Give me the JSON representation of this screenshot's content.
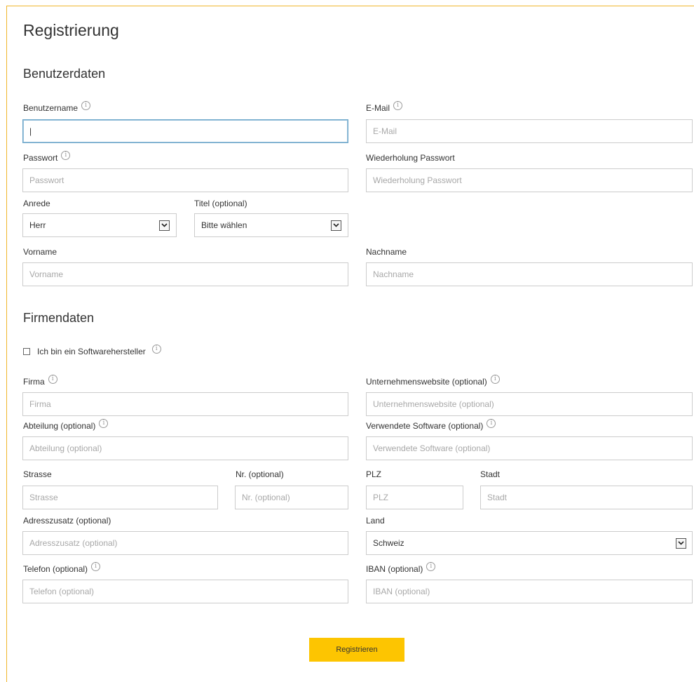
{
  "page": {
    "title": "Registrierung",
    "submit_label": "Registrieren"
  },
  "info_icon_glyph": "i",
  "colors": {
    "accent_border": "#f0b52a",
    "button_bg": "#fdc501",
    "focus_border": "#6aa5c9"
  },
  "sections": {
    "user": {
      "title": "Benutzerdaten"
    },
    "company": {
      "title": "Firmendaten"
    }
  },
  "fields": {
    "username": {
      "label": "Benutzername",
      "value": "|",
      "placeholder": ""
    },
    "email": {
      "label": "E-Mail",
      "placeholder": "E-Mail"
    },
    "password": {
      "label": "Passwort",
      "placeholder": "Passwort"
    },
    "password_repeat": {
      "label": "Wiederholung Passwort",
      "placeholder": "Wiederholung Passwort"
    },
    "salutation": {
      "label": "Anrede",
      "selected": "Herr"
    },
    "title": {
      "label": "Titel (optional)",
      "selected": "Bitte wählen"
    },
    "firstname": {
      "label": "Vorname",
      "placeholder": "Vorname"
    },
    "lastname": {
      "label": "Nachname",
      "placeholder": "Nachname"
    },
    "software_vendor": {
      "label": "Ich bin ein Softwarehersteller",
      "checked": false
    },
    "company": {
      "label": "Firma",
      "placeholder": "Firma"
    },
    "website": {
      "label": "Unternehmenswebsite (optional)",
      "placeholder": "Unternehmenswebsite (optional)"
    },
    "department": {
      "label": "Abteilung (optional)",
      "placeholder": "Abteilung (optional)"
    },
    "software_used": {
      "label": "Verwendete Software (optional)",
      "placeholder": "Verwendete Software (optional)"
    },
    "street": {
      "label": "Strasse",
      "placeholder": "Strasse"
    },
    "street_no": {
      "label": "Nr. (optional)",
      "placeholder": "Nr. (optional)"
    },
    "zip": {
      "label": "PLZ",
      "placeholder": "PLZ"
    },
    "city": {
      "label": "Stadt",
      "placeholder": "Stadt"
    },
    "address_extra": {
      "label": "Adresszusatz (optional)",
      "placeholder": "Adresszusatz (optional)"
    },
    "country": {
      "label": "Land",
      "selected": "Schweiz"
    },
    "phone": {
      "label": "Telefon (optional)",
      "placeholder": "Telefon (optional)"
    },
    "iban": {
      "label": "IBAN (optional)",
      "placeholder": "IBAN (optional)"
    }
  }
}
